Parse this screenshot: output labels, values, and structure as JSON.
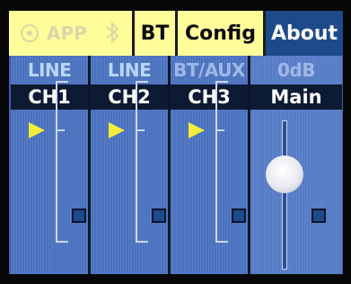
{
  "tabs": {
    "app_label": "APP",
    "bt_label": "BT",
    "config_label": "Config",
    "about_label": "About"
  },
  "channels": [
    {
      "source": "LINE",
      "name": "CH1"
    },
    {
      "source": "LINE",
      "name": "CH2"
    },
    {
      "source": "BT/AUX",
      "name": "CH3"
    }
  ],
  "main": {
    "level": "0dB",
    "name": "Main"
  },
  "colors": {
    "tab_bar": "#fffd9a",
    "active_tab": "#1d4a8a",
    "strip": "#4e76c4",
    "pointer": "#f2ec3a"
  }
}
